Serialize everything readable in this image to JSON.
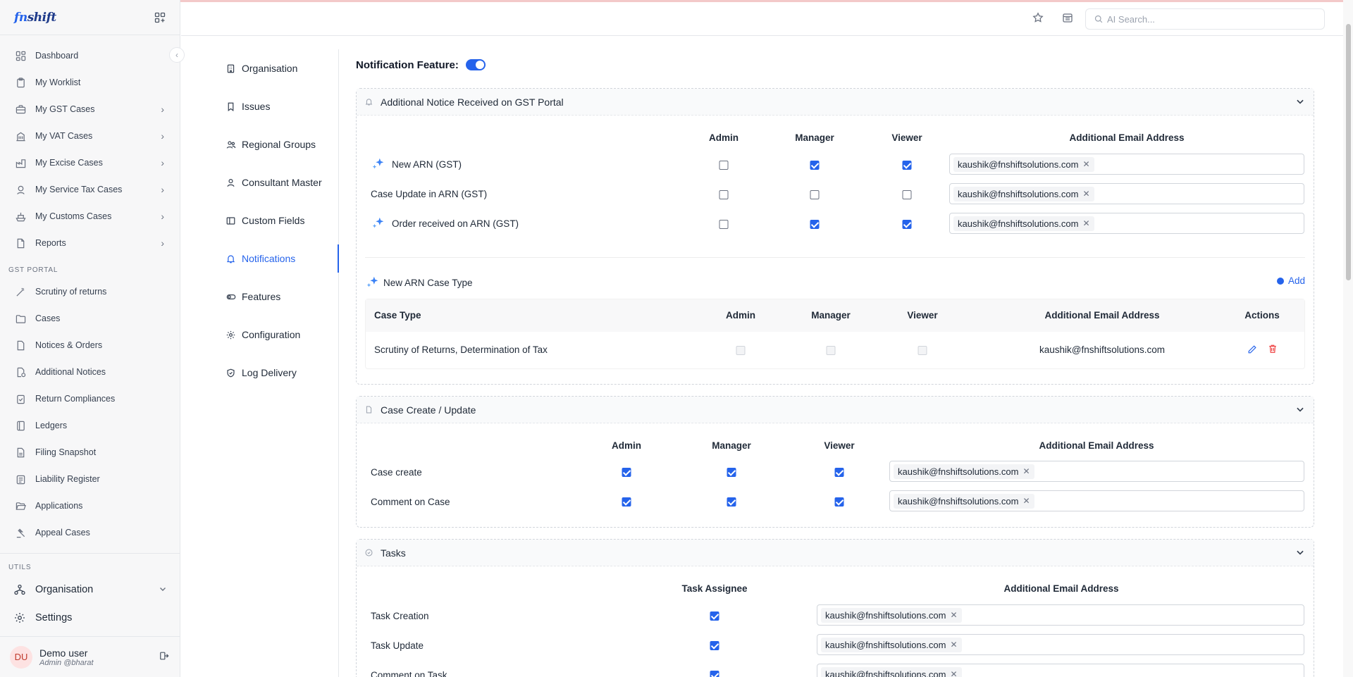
{
  "app": {
    "logo_prefix": "fn",
    "logo_rest": "shift"
  },
  "sidebar": {
    "items": [
      {
        "label": "Dashboard",
        "icon": "dashboard-icon",
        "chevron": false
      },
      {
        "label": "My Worklist",
        "icon": "clipboard-icon",
        "chevron": false
      },
      {
        "label": "My GST Cases",
        "icon": "briefcase-icon",
        "chevron": true
      },
      {
        "label": "My VAT Cases",
        "icon": "building-icon",
        "chevron": true
      },
      {
        "label": "My Excise Cases",
        "icon": "factory-icon",
        "chevron": true
      },
      {
        "label": "My Service Tax Cases",
        "icon": "service-icon",
        "chevron": true
      },
      {
        "label": "My Customs Cases",
        "icon": "ship-icon",
        "chevron": true
      },
      {
        "label": "Reports",
        "icon": "report-icon",
        "chevron": true
      }
    ],
    "gst_section": "GST PORTAL",
    "gst_items": [
      {
        "label": "Scrutiny of returns",
        "icon": "wand-icon"
      },
      {
        "label": "Cases",
        "icon": "folder-icon"
      },
      {
        "label": "Notices & Orders",
        "icon": "file-icon"
      },
      {
        "label": "Additional Notices",
        "icon": "notice-icon"
      },
      {
        "label": "Return Compliances",
        "icon": "checklist-icon"
      },
      {
        "label": "Ledgers",
        "icon": "ledger-icon"
      },
      {
        "label": "Filing Snapshot",
        "icon": "snapshot-icon"
      },
      {
        "label": "Liability Register",
        "icon": "register-icon"
      },
      {
        "label": "Applications",
        "icon": "folder-open-icon"
      },
      {
        "label": "Appeal Cases",
        "icon": "gavel-icon"
      }
    ],
    "utils_section": "UTILS",
    "utils_items": [
      {
        "label": "Organisation"
      },
      {
        "label": "Settings"
      }
    ],
    "user": {
      "initials": "DU",
      "name": "Demo user",
      "role": "Admin @bharat"
    }
  },
  "header": {
    "search_placeholder": "AI Search..."
  },
  "settings_nav": [
    {
      "label": "Organisation",
      "icon": "building-icon",
      "active": false
    },
    {
      "label": "Issues",
      "icon": "bookmark-icon",
      "active": false
    },
    {
      "label": "Regional Groups",
      "icon": "users-icon",
      "active": false
    },
    {
      "label": "Consultant Master",
      "icon": "user-icon",
      "active": false
    },
    {
      "label": "Custom Fields",
      "icon": "columns-icon",
      "active": false
    },
    {
      "label": "Notifications",
      "icon": "bell-icon",
      "active": true
    },
    {
      "label": "Features",
      "icon": "toggle-icon",
      "active": false
    },
    {
      "label": "Configuration",
      "icon": "gear-icon",
      "active": false
    },
    {
      "label": "Log Delivery",
      "icon": "shield-icon",
      "active": false
    }
  ],
  "main": {
    "feature_label": "Notification Feature:",
    "feature_enabled": true,
    "sections": {
      "additional_notice": {
        "title": "Additional Notice Received on GST Portal",
        "cols": [
          "Admin",
          "Manager",
          "Viewer",
          "Additional Email Address"
        ],
        "rows": [
          {
            "label": "New ARN (GST)",
            "sparkle": true,
            "admin": false,
            "manager": true,
            "viewer": true,
            "email": "kaushik@fnshiftsolutions.com"
          },
          {
            "label": "Case Update in ARN (GST)",
            "sparkle": false,
            "admin": false,
            "manager": false,
            "viewer": false,
            "email": "kaushik@fnshiftsolutions.com"
          },
          {
            "label": "Order received on ARN (GST)",
            "sparkle": true,
            "admin": false,
            "manager": true,
            "viewer": true,
            "email": "kaushik@fnshiftsolutions.com"
          }
        ],
        "case_type_title": "New ARN Case Type",
        "add_label": "Add",
        "table_cols": [
          "Case Type",
          "Admin",
          "Manager",
          "Viewer",
          "Additional Email Address",
          "Actions"
        ],
        "table_rows": [
          {
            "case_type": "Scrutiny of Returns, Determination of Tax",
            "email": "kaushik@fnshiftsolutions.com"
          }
        ]
      },
      "case_create": {
        "title": "Case Create / Update",
        "cols": [
          "Admin",
          "Manager",
          "Viewer",
          "Additional Email Address"
        ],
        "rows": [
          {
            "label": "Case create",
            "email": "kaushik@fnshiftsolutions.com"
          },
          {
            "label": "Comment on Case",
            "email": "kaushik@fnshiftsolutions.com"
          }
        ]
      },
      "tasks": {
        "title": "Tasks",
        "cols": [
          "Task Assignee",
          "Additional Email Address"
        ],
        "rows": [
          {
            "label": "Task Creation",
            "email": "kaushik@fnshiftsolutions.com"
          },
          {
            "label": "Task Update",
            "email": "kaushik@fnshiftsolutions.com"
          },
          {
            "label": "Comment on Task",
            "email": "kaushik@fnshiftsolutions.com"
          }
        ]
      }
    }
  },
  "colors": {
    "accent": "#2563eb",
    "danger": "#ef4444"
  }
}
